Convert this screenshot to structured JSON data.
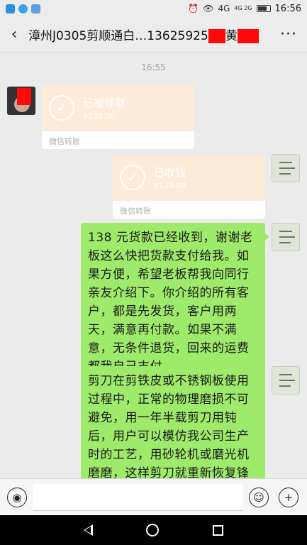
{
  "status_bar": {
    "network": "4G",
    "network_small": "4G 2G",
    "time": "16:56"
  },
  "header": {
    "title": "漳州J0305剪顺通白…13625925",
    "title_suffix": "黄",
    "back_icon": "chevron-left-icon",
    "more_icon": "more-dots-icon"
  },
  "chat": {
    "timestamp": "16:55",
    "transfer_received": {
      "status": "已被领取",
      "amount": "¥138.00",
      "footer": "微信转账"
    },
    "transfer_confirmed": {
      "status": "已收钱",
      "amount": "¥138.00",
      "footer": "微信转账"
    },
    "message_1": "138 元货款已经收到，谢谢老板这么快把货款支付给我。如果方便，希望老板帮我向同行亲友介绍下。你介绍的所有客户，都是先发货，客户用两天，满意再付款。如果不满意，无条件退货，回来的运费都我自己支付。",
    "message_2": "剪刀在剪铁皮或不锈钢板使用过程中，正常的物理磨损不可避免，用一年半载剪刀用钝后，用户可以模仿我公司生产时的工艺，用砂轮机或磨光机磨磨，这样剪刀就重新恢复锋利。（如果方便让"
  },
  "input_bar": {
    "voice_icon": "voice-icon",
    "emoji_icon": "emoji-icon",
    "add_icon": "plus-icon",
    "message_value": ""
  },
  "colors": {
    "bubble_green": "#9eea6a",
    "transfer_orange": "#fcebd9",
    "redaction_red": "#ff0a0a"
  }
}
